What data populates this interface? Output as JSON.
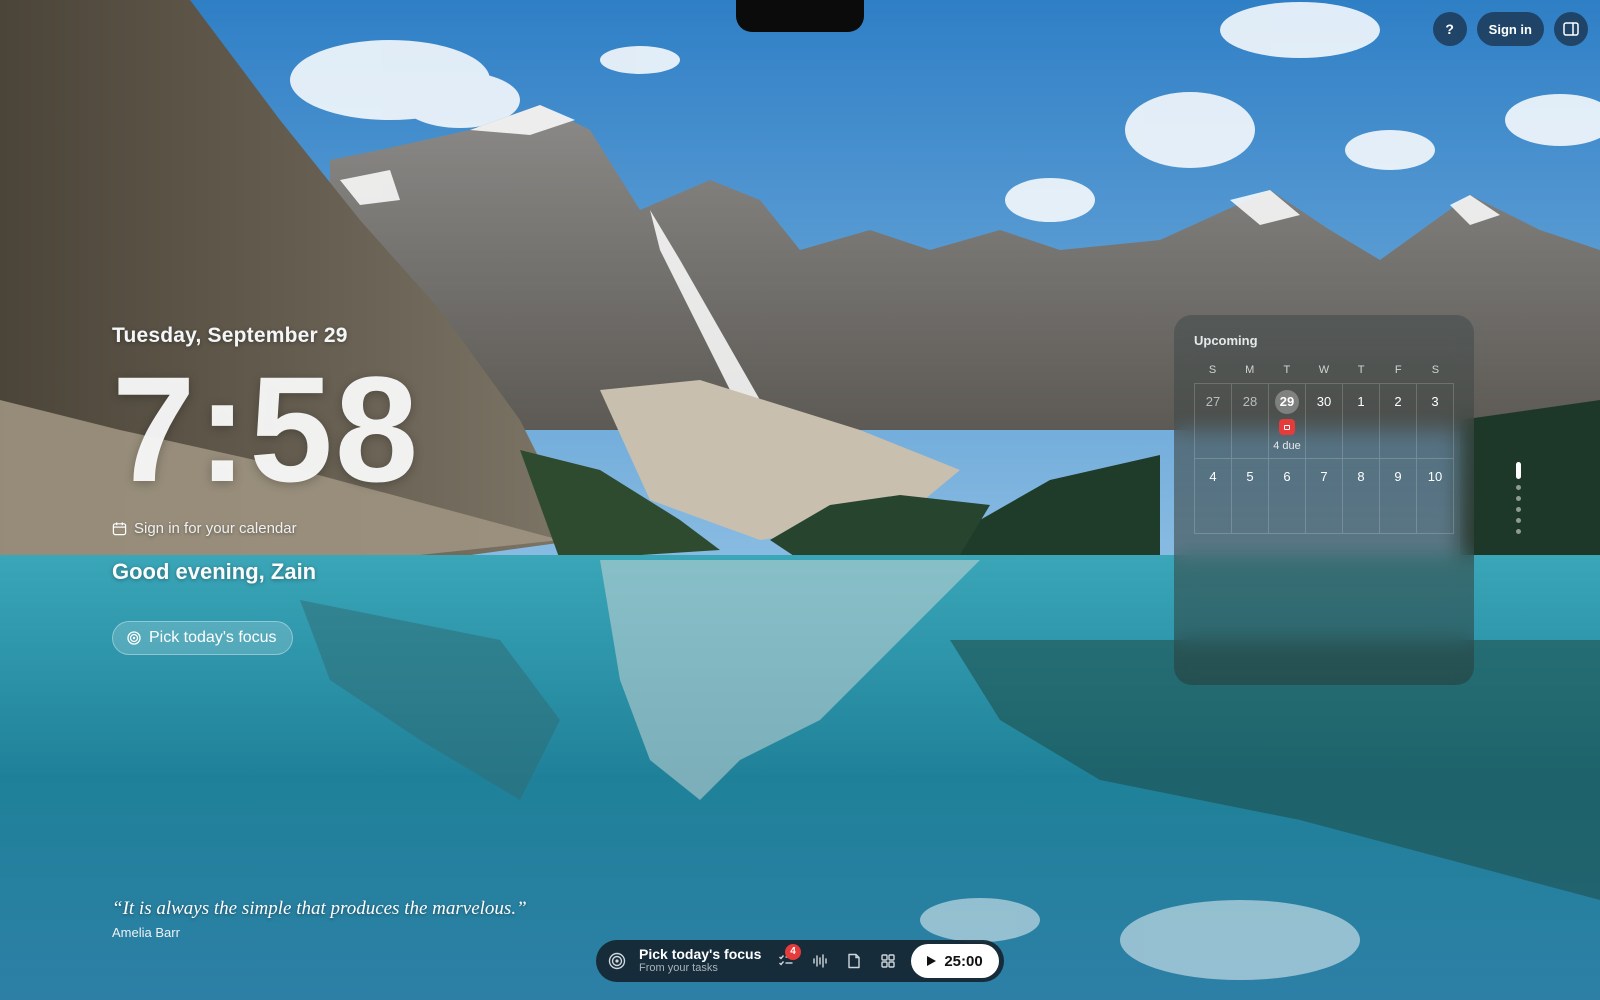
{
  "header": {
    "help_label": "?",
    "signin_label": "Sign in"
  },
  "clock": {
    "date": "Tuesday, September 29",
    "time": "7:58",
    "calendar_prompt": "Sign in for your calendar",
    "greeting": "Good evening, Zain",
    "focus_label": "Pick today's focus"
  },
  "calendar": {
    "title": "Upcoming",
    "weekdays": [
      "S",
      "M",
      "T",
      "W",
      "T",
      "F",
      "S"
    ],
    "week1": [
      "27",
      "28",
      "29",
      "30",
      "1",
      "2",
      "3"
    ],
    "week2": [
      "4",
      "5",
      "6",
      "7",
      "8",
      "9",
      "10"
    ],
    "due_text": "4 due"
  },
  "quote": {
    "text": "“It is always the simple that produces the marvelous.”",
    "author": "Amelia Barr"
  },
  "dock": {
    "title": "Pick today's focus",
    "subtitle": "From your tasks",
    "task_count": "4",
    "timer": "25:00"
  },
  "colors": {
    "accent_red": "#e53b3b",
    "sky": "#4a8fc8",
    "lake": "#2a8ea5"
  },
  "page_indicator": {
    "count": 6,
    "active_index": 0
  }
}
